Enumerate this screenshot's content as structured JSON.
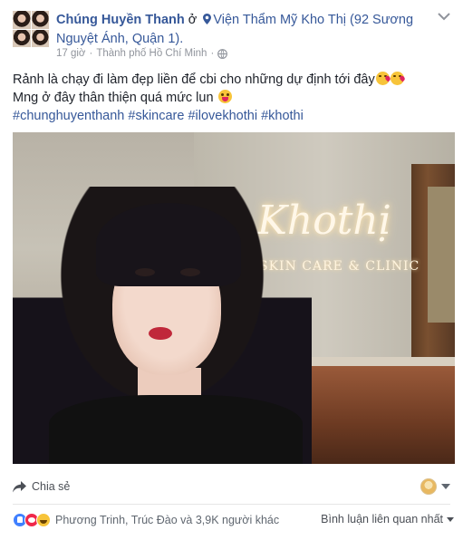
{
  "header": {
    "author": "Chúng Huyền Thanh",
    "connector": " ở ",
    "place": "Viện Thẩm Mỹ Kho Thị (92 Sương Nguyệt Ánh, Quận 1).",
    "time": "17 giờ",
    "separator": "·",
    "city": "Thành phố Hồ Chí Minh"
  },
  "post": {
    "line1": "Rảnh là chạy đi làm đẹp liền để cbi cho những dự định tới đây",
    "line2": "Mng ở đây thân thiện quá mức lun",
    "hashtags": "#chunghuyenthanh #skincare #ilovekhothi #khothi"
  },
  "photo": {
    "logo_text": "Khothị",
    "logo_sub": "SKIN CARE & CLINIC"
  },
  "actions": {
    "share_label": "Chia sẻ"
  },
  "reactions": {
    "text": "Phương Trinh, Trúc Đào và 3,9K người khác",
    "sort_label": "Bình luận liên quan nhất"
  },
  "colors": {
    "link": "#365899",
    "muted": "#90949c",
    "like": "#4080ff",
    "love": "#f0284a",
    "haha": "#f7c43a"
  },
  "icons": [
    "chevron-down-icon",
    "location-pin-icon",
    "globe-icon",
    "kiss-emoji-icon",
    "tongue-emoji-icon",
    "share-icon",
    "like-reaction-icon",
    "love-reaction-icon",
    "haha-reaction-icon"
  ]
}
